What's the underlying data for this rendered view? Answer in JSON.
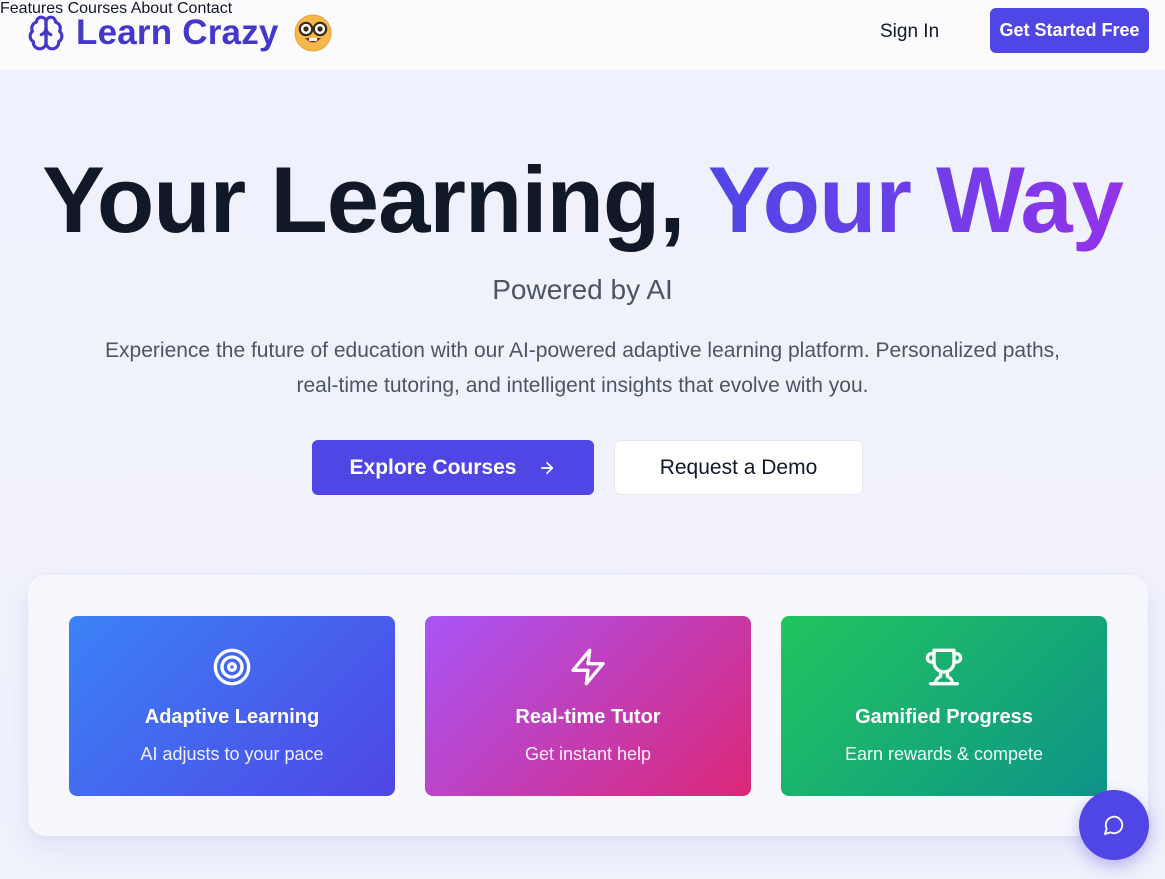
{
  "brand": {
    "name": "Learn Crazy",
    "logo_icon": "brain-icon",
    "emoji_icon": "nerd-face-emoji"
  },
  "nav": {
    "items": [
      "Features",
      "Courses",
      "About",
      "Contact"
    ],
    "sign_in": "Sign In",
    "cta": "Get Started Free"
  },
  "hero": {
    "title_plain": "Your Learning,",
    "title_accent": "Your Way",
    "subtitle": "Powered by AI",
    "description": "Experience the future of education with our AI-powered adaptive learning platform. Personalized paths, real-time tutoring, and intelligent insights that evolve with you.",
    "primary_button": "Explore Courses",
    "secondary_button": "Request a Demo"
  },
  "features": [
    {
      "title": "Adaptive Learning",
      "description": "AI adjusts to your pace",
      "icon": "target-icon",
      "colors": [
        "#3b82f6",
        "#4f46e5"
      ]
    },
    {
      "title": "Real-time Tutor",
      "description": "Get instant help",
      "icon": "lightning-icon",
      "colors": [
        "#a855f7",
        "#db2777"
      ]
    },
    {
      "title": "Gamified Progress",
      "description": "Earn rewards & compete",
      "icon": "trophy-icon",
      "colors": [
        "#22c55e",
        "#0d9488"
      ]
    }
  ],
  "chat": {
    "icon": "chat-bubble-icon"
  },
  "colors": {
    "accent": "#4f46e5",
    "brand_text": "#4338ca",
    "accent_purple": "#9333ea"
  }
}
